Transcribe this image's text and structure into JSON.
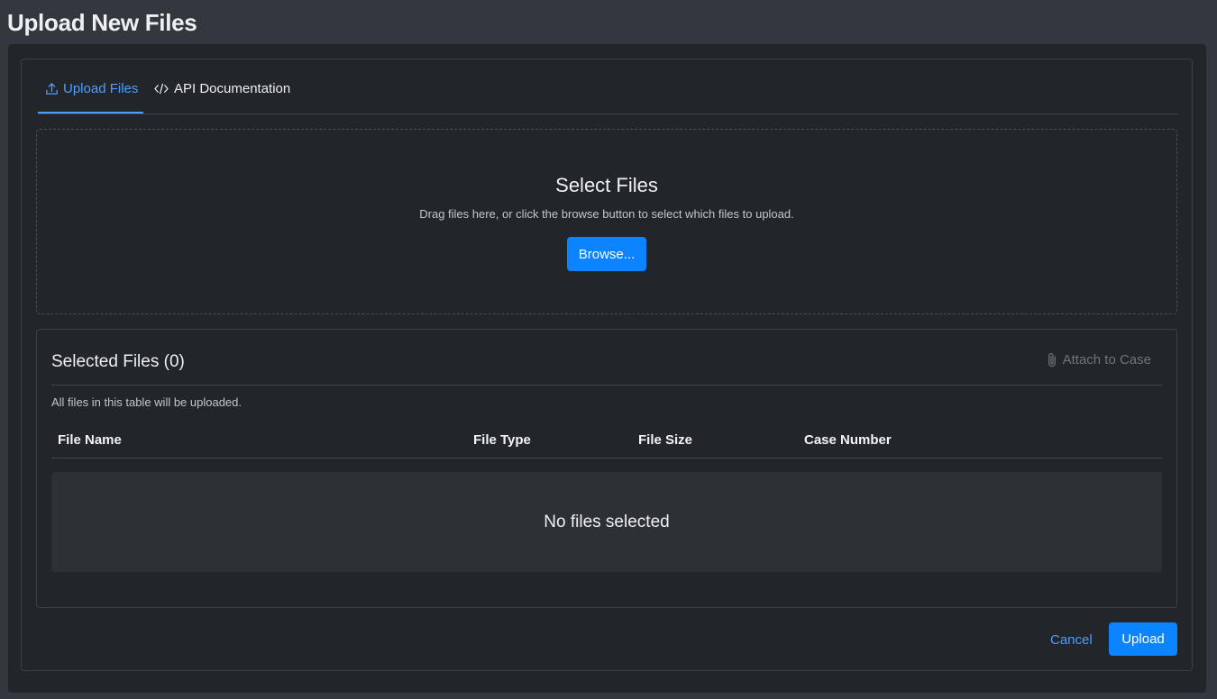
{
  "page": {
    "title": "Upload New Files"
  },
  "tabs": [
    {
      "label": "Upload Files",
      "icon": "upload-icon",
      "active": true
    },
    {
      "label": "API Documentation",
      "icon": "code-icon",
      "active": false
    }
  ],
  "dropzone": {
    "title": "Select Files",
    "subtitle": "Drag files here, or click the browse button to select which files to upload.",
    "browse_label": "Browse..."
  },
  "selected_files": {
    "title": "Selected Files (0)",
    "attach_label": "Attach to Case",
    "attach_icon": "paperclip-icon",
    "note": "All files in this table will be uploaded.",
    "columns": [
      "File Name",
      "File Type",
      "File Size",
      "Case Number"
    ],
    "rows": [],
    "empty_text": "No files selected"
  },
  "footer": {
    "cancel_label": "Cancel",
    "upload_label": "Upload"
  },
  "colors": {
    "accent": "#0d84ff",
    "link": "#4f9dff",
    "background": "#22252a",
    "page_bg": "#33373e"
  }
}
